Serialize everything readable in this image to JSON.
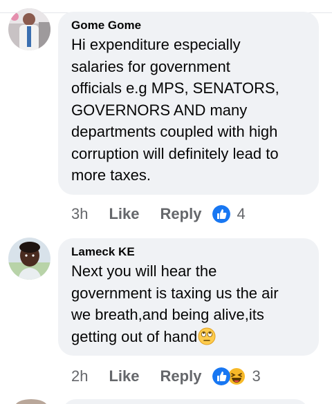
{
  "comments": [
    {
      "author": "Gome Gome",
      "text": "Hi expenditure especially\nsalaries for government\nofficials e.g MPS, SENATORS,\nGOVERNORS AND many\ndepartments coupled with high\ncorruption will definitely lead to\nmore taxes.",
      "time": "3h",
      "like_label": "Like",
      "reply_label": "Reply",
      "reactions": [
        "like-reaction-icon"
      ],
      "reaction_count": "4"
    },
    {
      "author": "Lameck KE",
      "text": "Next you will hear the\ngovernment is taxing us the air\nwe breath,and being alive,its\ngetting out of hand",
      "time": "2h",
      "like_label": "Like",
      "reply_label": "Reply",
      "reactions": [
        "like-reaction-icon",
        "haha-reaction-icon"
      ],
      "reaction_count": "3"
    }
  ],
  "colors": {
    "bubble": "#f0f2f5",
    "meta_text": "#65676b",
    "like_blue": "#1877f2",
    "haha_yellow": "#f7b928"
  }
}
